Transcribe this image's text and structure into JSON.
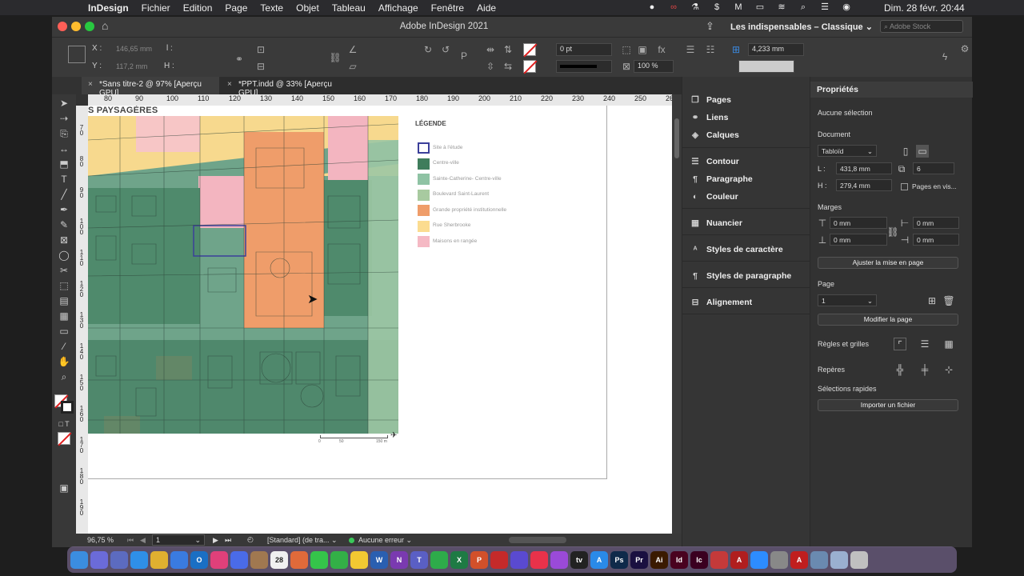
{
  "menubar": {
    "app": "InDesign",
    "items": [
      "Fichier",
      "Edition",
      "Page",
      "Texte",
      "Objet",
      "Tableau",
      "Affichage",
      "Fenêtre",
      "Aide"
    ],
    "clock": "Dim. 28 févr.  20:44"
  },
  "window": {
    "title": "Adobe InDesign 2021",
    "workspace": "Les indispensables – Classique",
    "stock_placeholder": "Adobe Stock"
  },
  "control": {
    "x_label": "X :",
    "x_value": "146,65 mm",
    "y_label": "Y :",
    "y_value": "117,2 mm",
    "l_label": "l :",
    "h_label": "H :",
    "stroke_weight": "0 pt",
    "opacity": "100 %",
    "size_value": "4,233 mm"
  },
  "tabs": [
    {
      "label": "*Sans titre-2 @ 97% [Aperçu GPU]"
    },
    {
      "label": "*PPT.indd @ 33% [Aperçu GPU]"
    }
  ],
  "ruler": {
    "h_ticks": [
      "80",
      "90",
      "100",
      "110",
      "120",
      "130",
      "140",
      "150",
      "160",
      "170",
      "180",
      "190",
      "200",
      "210",
      "220",
      "230",
      "240",
      "250",
      "26"
    ],
    "v_ticks": [
      "70",
      "80",
      "90",
      "100",
      "110",
      "120",
      "130",
      "140",
      "150",
      "160",
      "170",
      "180",
      "190"
    ]
  },
  "document": {
    "map_title": "S PAYSAGÈRES",
    "legend_title": "LÉGENDE",
    "legend": [
      {
        "label": "Site à l'étude",
        "color": "#ffffff",
        "border": "#3b3f9a"
      },
      {
        "label": "Centre-ville",
        "color": "#3f7d5c"
      },
      {
        "label": "Sainte-Catherine- Centre-ville",
        "color": "#8fc3a4"
      },
      {
        "label": "Boulevard Saint-Laurent",
        "color": "#a8caa0"
      },
      {
        "label": "Grande propriété institutionnelle",
        "color": "#ef9d6a"
      },
      {
        "label": "Rue Sherbrooke",
        "color": "#fbdc90"
      },
      {
        "label": "Maisons en rangée",
        "color": "#f5b9c4"
      }
    ],
    "scale_labels": [
      "0",
      "50",
      "150 m"
    ]
  },
  "status": {
    "zoom": "96,75 %",
    "page": "1",
    "profile": "[Standard] (de tra...",
    "errors": "Aucune erreur"
  },
  "mid_panel": {
    "items": [
      {
        "label": "Pages",
        "icon": "pages-icon"
      },
      {
        "label": "Liens",
        "icon": "links-icon"
      },
      {
        "label": "Calques",
        "icon": "layers-icon"
      },
      {
        "label": "Contour",
        "icon": "stroke-icon"
      },
      {
        "label": "Paragraphe",
        "icon": "paragraph-icon"
      },
      {
        "label": "Couleur",
        "icon": "color-icon"
      },
      {
        "label": "Nuancier",
        "icon": "swatches-icon"
      },
      {
        "label": "Styles de caractère",
        "icon": "char-styles-icon"
      },
      {
        "label": "Styles de paragraphe",
        "icon": "para-styles-icon"
      },
      {
        "label": "Alignement",
        "icon": "align-icon"
      }
    ]
  },
  "properties": {
    "tab": "Propriétés",
    "selection": "Aucune sélection",
    "document_label": "Document",
    "preset": "Tabloïd",
    "width_label": "L :",
    "width": "431,8 mm",
    "height_label": "H :",
    "height": "279,4 mm",
    "pages_count": "6",
    "facing_pages": "Pages en vis...",
    "margins_label": "Marges",
    "margin_top": "0 mm",
    "margin_bottom": "0 mm",
    "margin_left": "0 mm",
    "margin_right": "0 mm",
    "adjust_button": "Ajuster la mise en page",
    "page_label": "Page",
    "page_value": "1",
    "edit_page_button": "Modifier la page",
    "rulers_label": "Règles et grilles",
    "guides_label": "Repères",
    "quick_actions_label": "Sélections rapides",
    "import_button": "Importer un fichier"
  },
  "dock": {
    "apps": [
      {
        "name": "finder",
        "label": "",
        "color": "#3b8de0"
      },
      {
        "name": "launchpad",
        "label": "",
        "color": "#6b6bd8"
      },
      {
        "name": "apps",
        "label": "",
        "color": "#5c6bc0"
      },
      {
        "name": "safari",
        "label": "",
        "color": "#2f8fe8"
      },
      {
        "name": "chrome",
        "label": "",
        "color": "#e0b030"
      },
      {
        "name": "mail",
        "label": "",
        "color": "#3a7be0"
      },
      {
        "name": "outlook",
        "label": "O",
        "color": "#1a6fc4"
      },
      {
        "name": "photos",
        "label": "",
        "color": "#e0407a"
      },
      {
        "name": "messenger",
        "label": "",
        "color": "#4a6be8"
      },
      {
        "name": "contacts",
        "label": "",
        "color": "#a07850"
      },
      {
        "name": "calendar",
        "label": "28",
        "color": "#f0f0f0"
      },
      {
        "name": "photos2",
        "label": "",
        "color": "#e06a3a"
      },
      {
        "name": "messages",
        "label": "",
        "color": "#35c44a"
      },
      {
        "name": "facetime",
        "label": "",
        "color": "#33b047"
      },
      {
        "name": "notes",
        "label": "",
        "color": "#f2c832"
      },
      {
        "name": "word",
        "label": "W",
        "color": "#2a5fb0"
      },
      {
        "name": "onenote",
        "label": "N",
        "color": "#7a3ab0"
      },
      {
        "name": "teams",
        "label": "T",
        "color": "#5a5fc4"
      },
      {
        "name": "numbers",
        "label": "",
        "color": "#2eab4a"
      },
      {
        "name": "excel",
        "label": "X",
        "color": "#1e7a44"
      },
      {
        "name": "powerpoint",
        "label": "P",
        "color": "#d2502a"
      },
      {
        "name": "acrobat",
        "label": "",
        "color": "#c42a2a"
      },
      {
        "name": "imovie",
        "label": "",
        "color": "#5a4ad0"
      },
      {
        "name": "music",
        "label": "",
        "color": "#e8324a"
      },
      {
        "name": "podcasts",
        "label": "",
        "color": "#9a4ad8"
      },
      {
        "name": "appletv",
        "label": "tv",
        "color": "#222222"
      },
      {
        "name": "appstore",
        "label": "A",
        "color": "#2a8ae8"
      },
      {
        "name": "photoshop",
        "label": "Ps",
        "color": "#0f2a4a"
      },
      {
        "name": "premiere",
        "label": "Pr",
        "color": "#1a1040"
      },
      {
        "name": "illustrator",
        "label": "Ai",
        "color": "#3a1a00"
      },
      {
        "name": "indesign",
        "label": "Id",
        "color": "#49021f"
      },
      {
        "name": "incopy",
        "label": "Ic",
        "color": "#3a0020"
      },
      {
        "name": "sysprefs2",
        "label": "",
        "color": "#c43a3a"
      },
      {
        "name": "acrobat2",
        "label": "A",
        "color": "#b01e1e"
      },
      {
        "name": "zoom",
        "label": "",
        "color": "#2d8cff"
      },
      {
        "name": "settings",
        "label": "",
        "color": "#888888"
      },
      {
        "name": "acrobat3",
        "label": "A",
        "color": "#c01e1e"
      },
      {
        "name": "finder2",
        "label": "",
        "color": "#6a8ab0"
      },
      {
        "name": "downloads",
        "label": "",
        "color": "#9ab0d0"
      },
      {
        "name": "trash",
        "label": "",
        "color": "#c0c0c0"
      }
    ]
  },
  "colors": {
    "accent": "#49021f"
  }
}
